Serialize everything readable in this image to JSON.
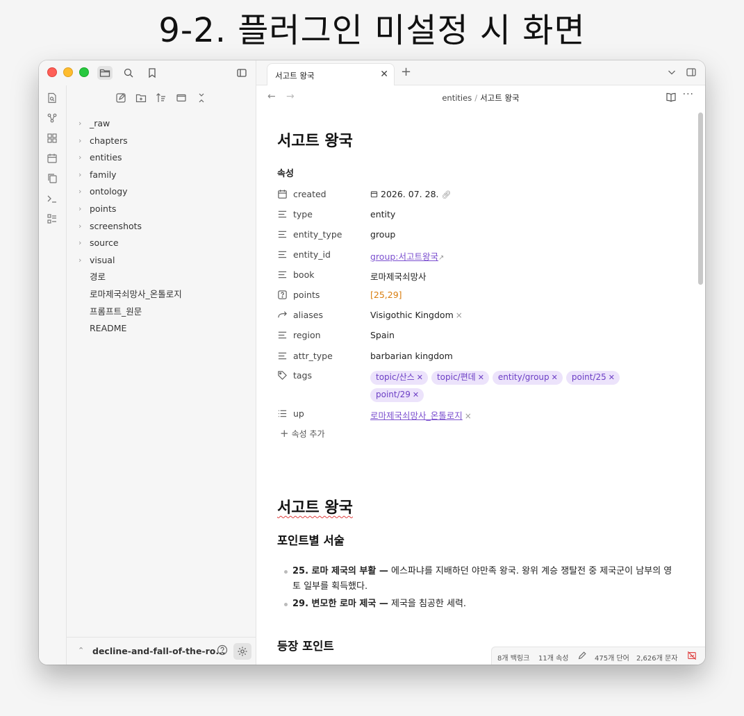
{
  "page_heading": "9-2. 플러그인 미설정 시 화면",
  "tab": {
    "label": "서고트 왕국",
    "close": "✕",
    "new": "+"
  },
  "breadcrumb": {
    "folder": "entities",
    "separator": "/",
    "current": "서고트 왕국"
  },
  "explorer": {
    "folders": [
      "_raw",
      "chapters",
      "entities",
      "family",
      "ontology",
      "points",
      "screenshots",
      "source",
      "visual"
    ],
    "files": [
      "경로",
      "로마제국쇠망사_온톨로지",
      "프롬프트_원문",
      "README"
    ],
    "vault_name": "decline-and-fall-of-the-ro..."
  },
  "note": {
    "title": "서고트 왕국",
    "properties_heading": "속성",
    "properties": {
      "created": {
        "key": "created",
        "value": "2026. 07. 28."
      },
      "type": {
        "key": "type",
        "value": "entity"
      },
      "entity_type": {
        "key": "entity_type",
        "value": "group"
      },
      "entity_id": {
        "key": "entity_id",
        "value": "group:서고트왕국"
      },
      "book": {
        "key": "book",
        "value": "로마제국쇠망사"
      },
      "points": {
        "key": "points",
        "value": "[25,29]"
      },
      "aliases": {
        "key": "aliases",
        "value": "Visigothic Kingdom"
      },
      "region": {
        "key": "region",
        "value": "Spain"
      },
      "attr_type": {
        "key": "attr_type",
        "value": "barbarian kingdom"
      },
      "tags": {
        "key": "tags",
        "values": [
          "topic/산스",
          "topic/편데",
          "entity/group",
          "point/25",
          "point/29"
        ]
      },
      "up": {
        "key": "up",
        "value": "로마제국쇠망사_온톨로지"
      }
    },
    "add_property": "속성 추가",
    "body_title": "서고트 왕국",
    "section1": "포인트별 서술",
    "bullets": [
      {
        "bold": "25. 로마 제국의 부활 —",
        "text": " 에스파냐를 지배하던 야만족 왕국. 왕위 계승 쟁탈전 중 제국군이 남부의 영토 일부를 획득했다."
      },
      {
        "bold": "29. 변모한 로마 제국 —",
        "text": " 제국을 침공한 세력."
      }
    ],
    "section2": "등장 포인트"
  },
  "status": {
    "backlinks": "8개 백링크",
    "properties": "11개 속성",
    "words": "475개 단어",
    "chars": "2,626개 문자"
  },
  "colors": {
    "link": "#7b4fcf",
    "tag_bg": "#ece3fb",
    "orange": "#d97d0d",
    "sync_error": "#e04646"
  }
}
